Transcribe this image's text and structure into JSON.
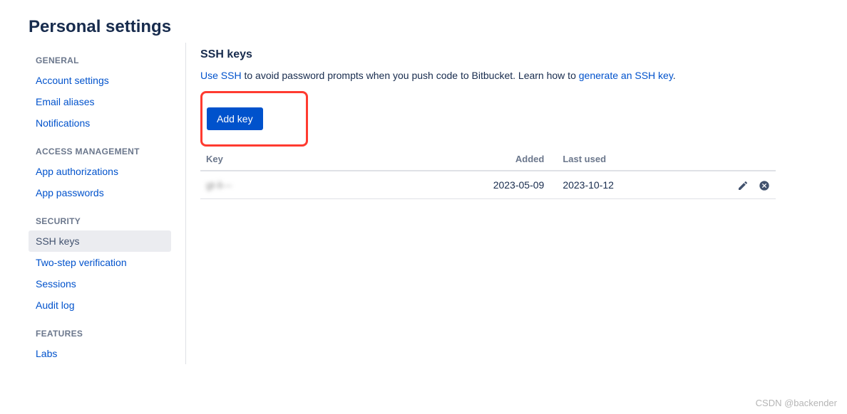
{
  "page_title": "Personal settings",
  "sidebar": {
    "groups": [
      {
        "label": "GENERAL",
        "items": [
          {
            "label": "Account settings"
          },
          {
            "label": "Email aliases"
          },
          {
            "label": "Notifications"
          }
        ]
      },
      {
        "label": "ACCESS MANAGEMENT",
        "items": [
          {
            "label": "App authorizations"
          },
          {
            "label": "App passwords"
          }
        ]
      },
      {
        "label": "SECURITY",
        "items": [
          {
            "label": "SSH keys",
            "active": true
          },
          {
            "label": "Two-step verification"
          },
          {
            "label": "Sessions"
          },
          {
            "label": "Audit log"
          }
        ]
      },
      {
        "label": "FEATURES",
        "items": [
          {
            "label": "Labs"
          }
        ]
      }
    ]
  },
  "content": {
    "title": "SSH keys",
    "desc_link1": "Use SSH",
    "desc_text": " to avoid password prompts when you push code to Bitbucket. Learn how to ",
    "desc_link2": "generate an SSH key",
    "desc_tail": ".",
    "add_key_label": "Add key",
    "table": {
      "headers": {
        "key": "Key",
        "added": "Added",
        "last_used": "Last used"
      },
      "rows": [
        {
          "key": "gt-li---",
          "added": "2023-05-09",
          "last_used": "2023-10-12"
        }
      ]
    }
  },
  "watermark": "CSDN @backender"
}
